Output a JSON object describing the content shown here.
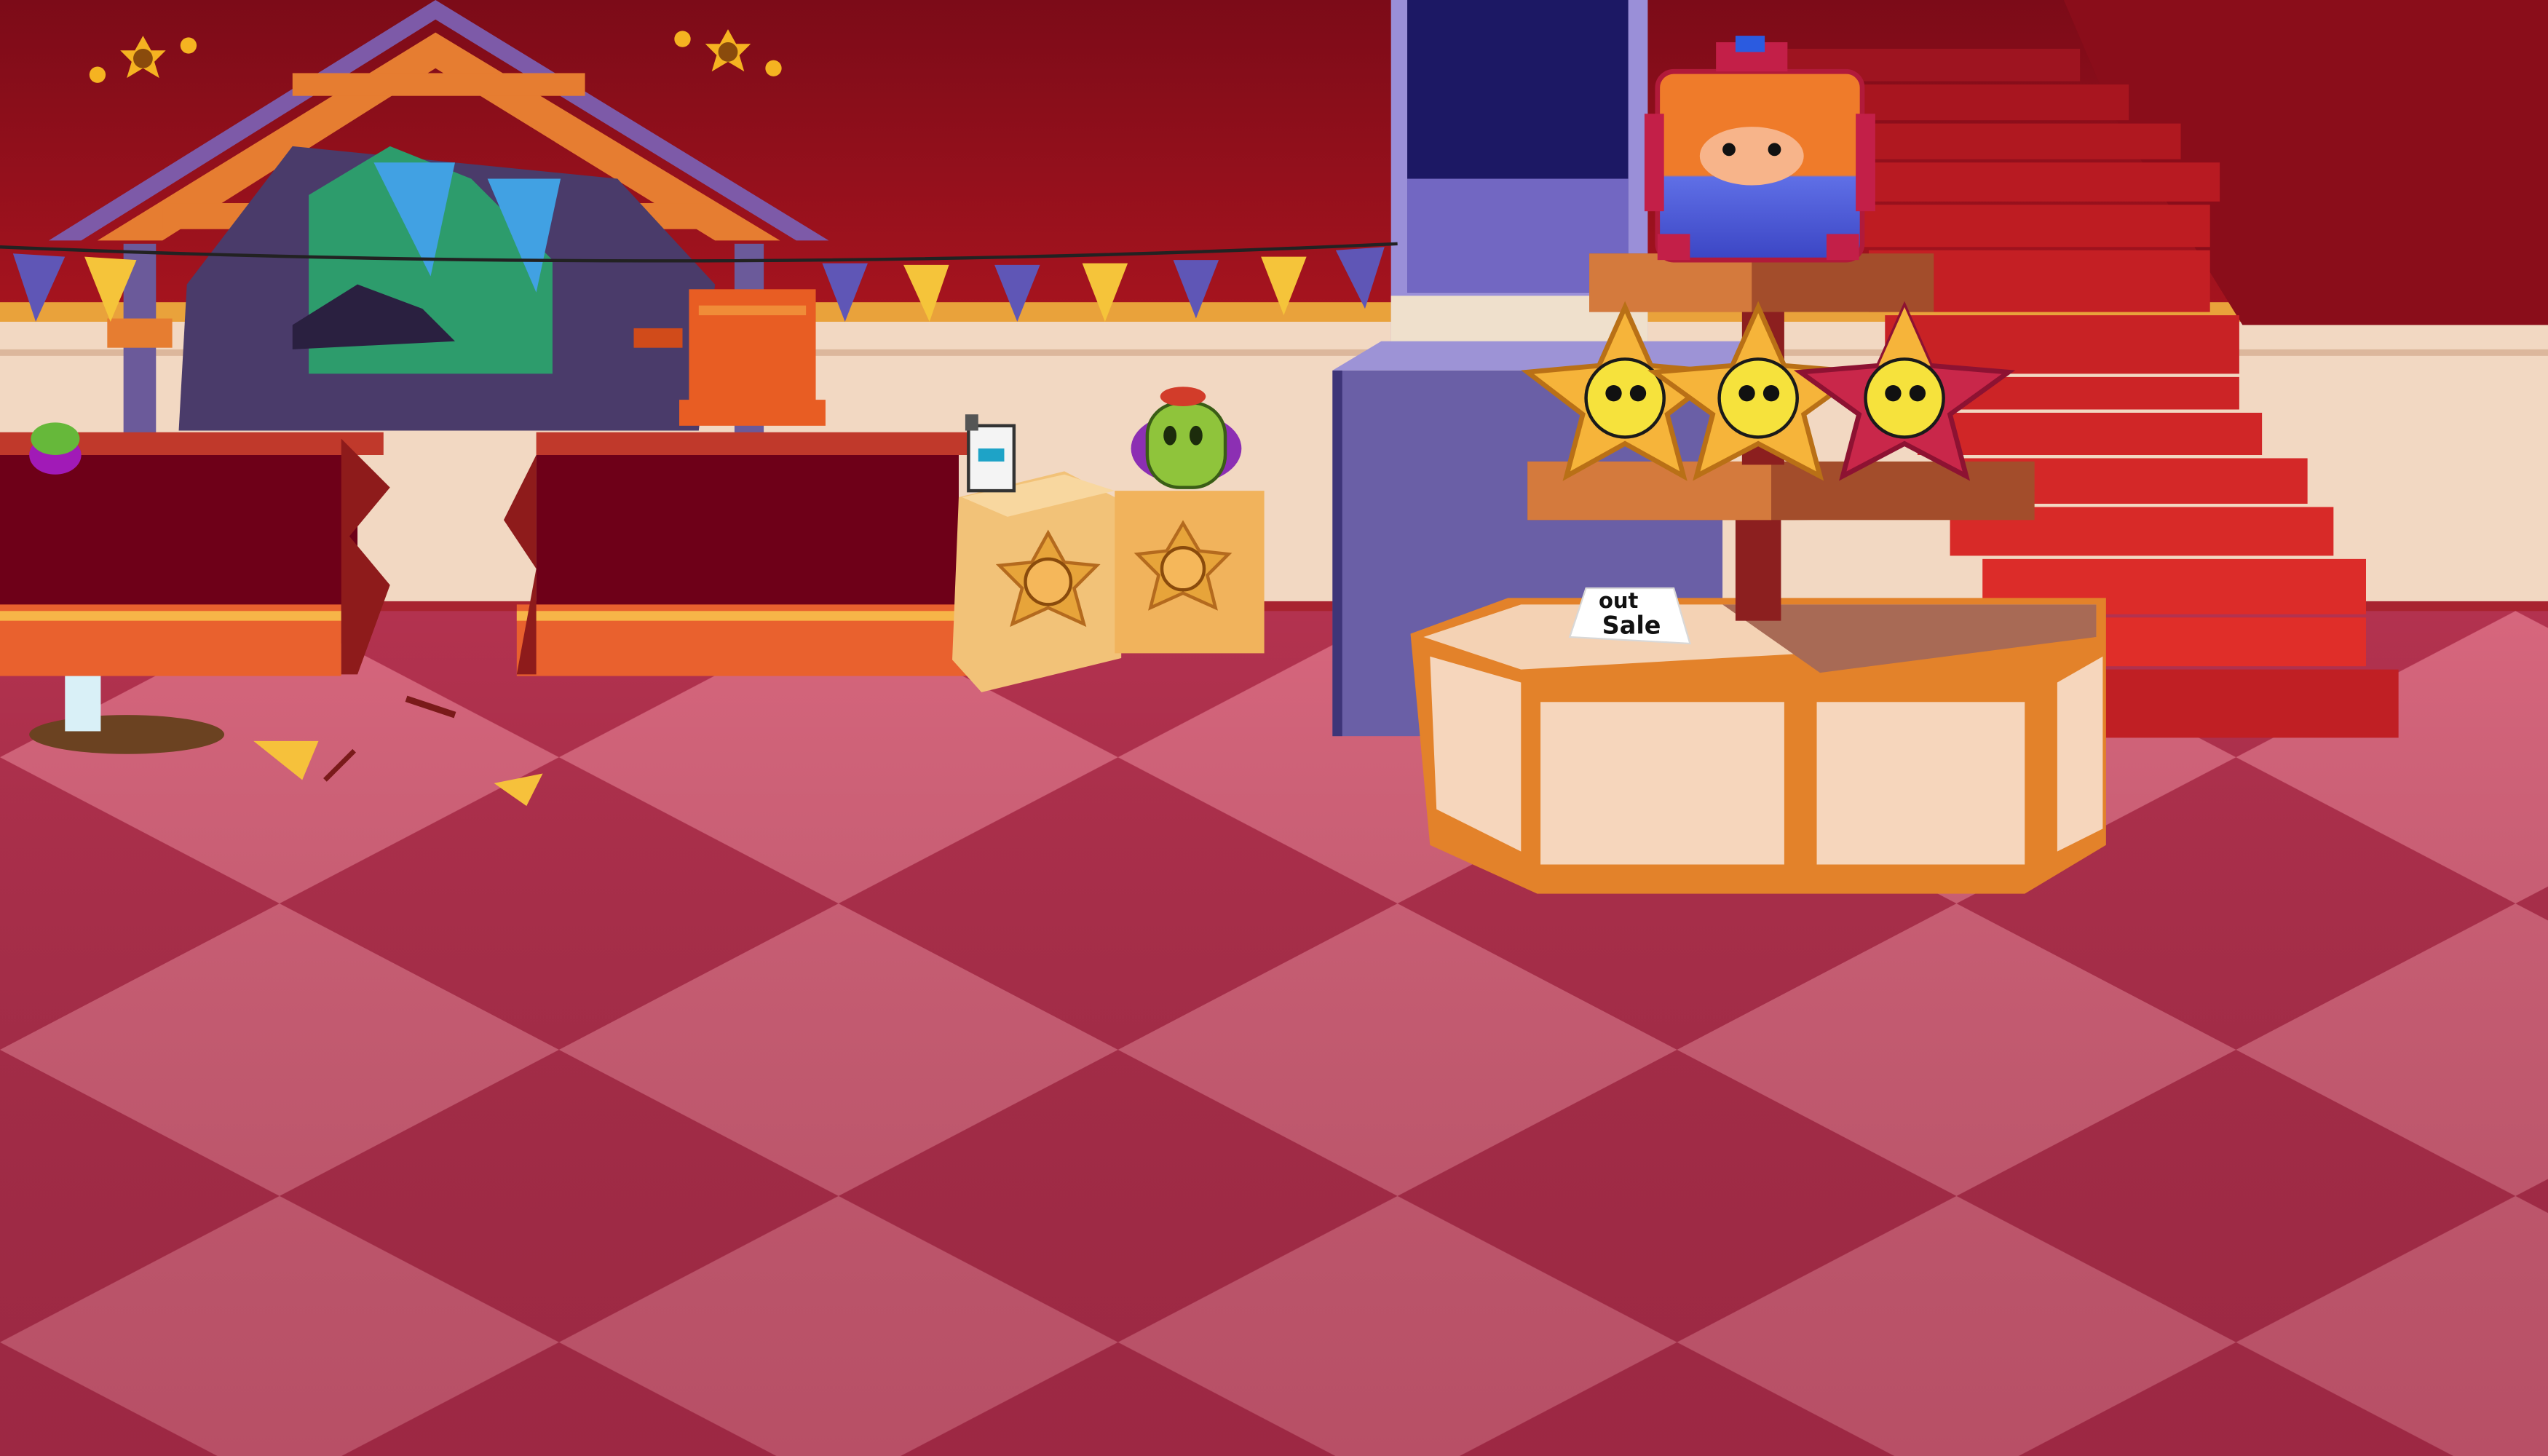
{
  "scene": {
    "description_label": "",
    "sale_sign": {
      "line1": "out",
      "line2": "Sale"
    },
    "colors": {
      "floor_light": "#d9667e",
      "floor_dark": "#b2304e",
      "wall_top": "#8e0f1e",
      "wall_band": "#f2d8c2",
      "accent_orange": "#e8762a",
      "carpet_red": "#c42124",
      "pillar_purple": "#6a5fa6"
    },
    "icons": [
      "star-coin-icon",
      "skull-coin-icon",
      "robot-figure-icon",
      "cactus-figure-icon",
      "crown-robot-figure-icon"
    ]
  }
}
